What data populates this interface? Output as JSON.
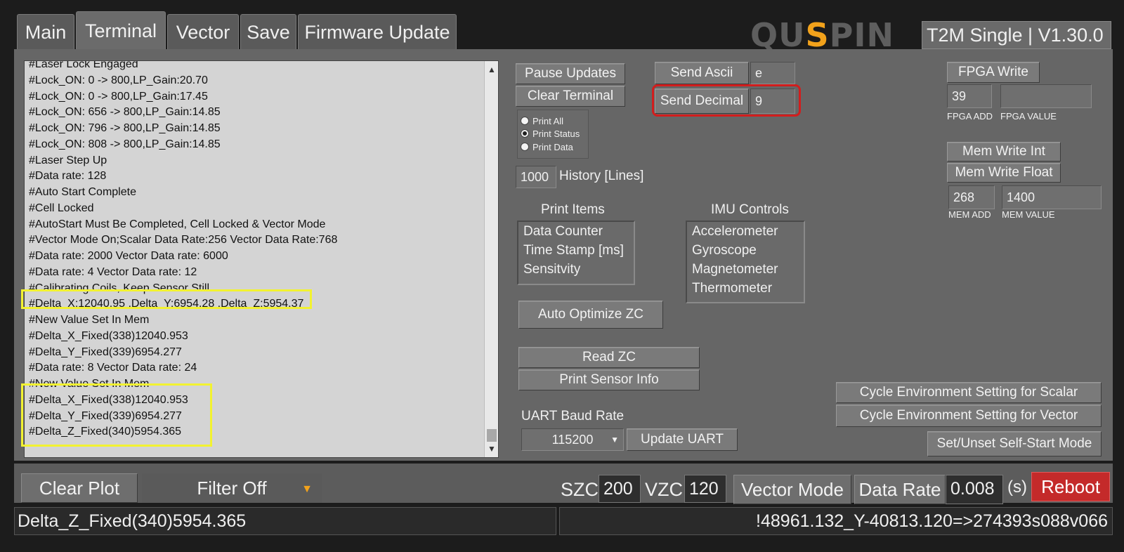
{
  "tabs": [
    {
      "label": "Main"
    },
    {
      "label": "Terminal"
    },
    {
      "label": "Vector"
    },
    {
      "label": "Save"
    },
    {
      "label": "Firmware Update"
    }
  ],
  "header": {
    "logo_part1": "QU",
    "logo_accent": "S",
    "logo_part2": "PIN",
    "version": "T2M Single | V1.30.0"
  },
  "terminal": {
    "lines": [
      "#Laser Lock Engaged",
      "#Lock_ON: 0 -> 800,LP_Gain:20.70",
      "#Lock_ON: 0 -> 800,LP_Gain:17.45",
      "#Lock_ON: 656 -> 800,LP_Gain:14.85",
      "#Lock_ON: 796 -> 800,LP_Gain:14.85",
      "#Lock_ON: 808 -> 800,LP_Gain:14.85",
      "#Laser Step Up",
      "#Data rate: 128",
      "#Auto Start Complete",
      "#Cell Locked",
      "#AutoStart Must Be Completed, Cell Locked & Vector Mode",
      "#Vector Mode On;Scalar Data Rate:256 Vector Data Rate:768",
      "#Data rate: 2000 Vector Data rate: 6000",
      "#Data rate: 4 Vector Data rate: 12",
      "#Calibrating Coils, Keep Sensor Still",
      "#Delta_X:12040.95 ,Delta_Y:6954.28 ,Delta_Z:5954.37",
      "#New Value Set In Mem",
      "#Delta_X_Fixed(338)12040.953",
      "#Delta_Y_Fixed(339)6954.277",
      "#Data rate: 8 Vector Data rate: 24",
      "#New Value Set In Mem",
      "#Delta_X_Fixed(338)12040.953",
      "#Delta_Y_Fixed(339)6954.277",
      "#Delta_Z_Fixed(340)5954.365"
    ]
  },
  "controls": {
    "pause_updates": "Pause Updates",
    "clear_terminal": "Clear Terminal",
    "print_options": [
      {
        "label": "Print All",
        "selected": false
      },
      {
        "label": "Print Status",
        "selected": true
      },
      {
        "label": "Print Data",
        "selected": false
      }
    ],
    "history_value": "1000",
    "history_label": "History [Lines]",
    "send_ascii": "Send Ascii",
    "ascii_value": "e",
    "send_decimal": "Send Decimal",
    "decimal_value": "9",
    "print_items_title": "Print Items",
    "print_items": [
      "Data Counter",
      "Time Stamp [ms]",
      "Sensitvity"
    ],
    "imu_title": "IMU Controls",
    "imu_items": [
      "Accelerometer",
      "Gyroscope",
      "Magnetometer",
      "Thermometer"
    ],
    "auto_optimize": "Auto Optimize ZC",
    "read_zc": "Read ZC",
    "print_sensor_info": "Print Sensor Info",
    "uart_label": "UART Baud Rate",
    "uart_value": "115200",
    "update_uart": "Update UART",
    "fpga_write": "FPGA Write",
    "fpga_add_value": "39",
    "fpga_value_value": "",
    "fpga_add_label": "FPGA ADD",
    "fpga_value_label": "FPGA VALUE",
    "mem_write_int": "Mem Write Int",
    "mem_write_float": "Mem Write Float",
    "mem_add_value": "268",
    "mem_value_value": "1400",
    "mem_add_label": "MEM ADD",
    "mem_value_label": "MEM VALUE",
    "cycle_scalar": "Cycle Environment Setting for Scalar",
    "cycle_vector": "Cycle Environment Setting for Vector",
    "self_start": "Set/Unset Self-Start Mode"
  },
  "bottom": {
    "clear_plot": "Clear Plot",
    "filter": "Filter Off",
    "szc_label": "SZC",
    "szc_value": "200",
    "vzc_label": "VZC",
    "vzc_value": "120",
    "vector_mode": "Vector Mode",
    "data_rate_label": "Data Rate",
    "data_rate_value": "0.008",
    "data_rate_unit": "(s)",
    "reboot": "Reboot"
  },
  "status": {
    "left": "Delta_Z_Fixed(340)5954.365",
    "right": "!48961.132_Y-40813.120=>274393s088v066"
  },
  "colors": {
    "accent": "#f2a21b",
    "highlight_yellow": "#f2f230",
    "highlight_red": "#d21d1d",
    "reboot": "#c42a2a"
  }
}
